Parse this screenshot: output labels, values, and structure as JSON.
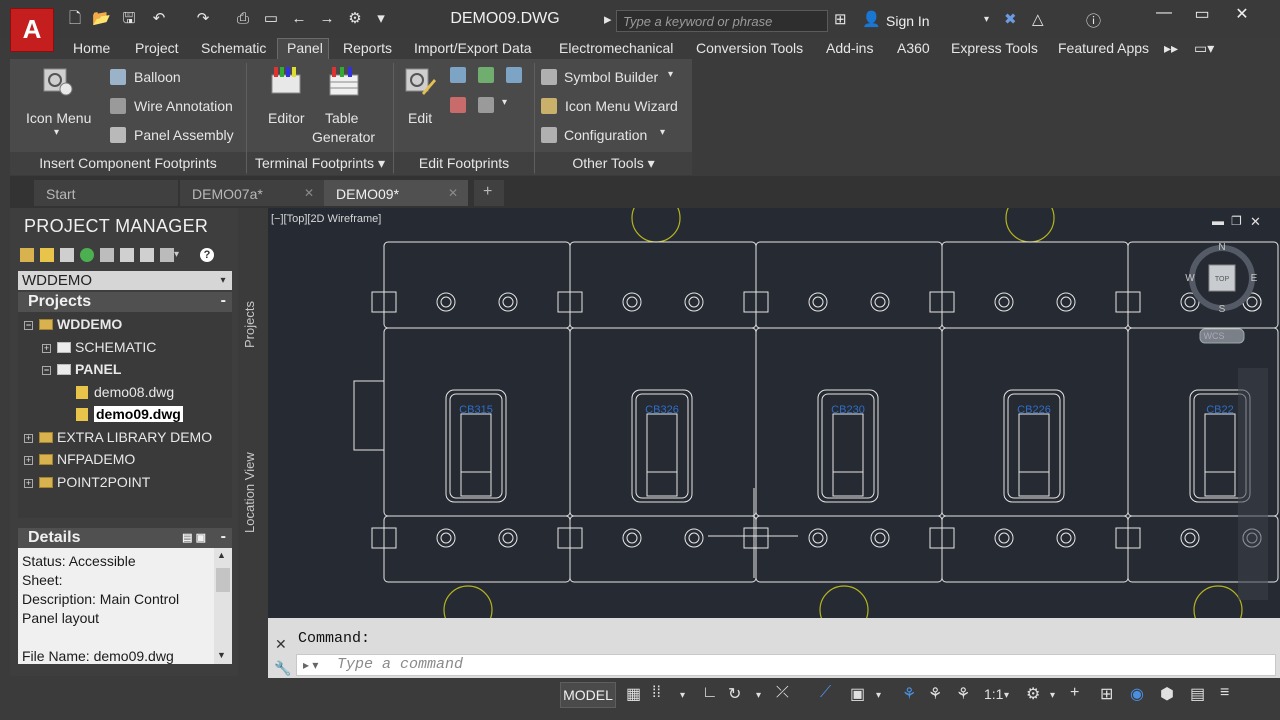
{
  "app": {
    "logo": "A",
    "document_title": "DEMO09.DWG"
  },
  "search": {
    "placeholder": "Type a keyword or phrase"
  },
  "account": {
    "sign_in_label": "Sign In"
  },
  "ribbon_tabs": [
    "Home",
    "Project",
    "Schematic",
    "Panel",
    "Reports",
    "Import/Export Data",
    "Electromechanical",
    "Conversion Tools",
    "Add-ins",
    "A360",
    "Express Tools",
    "Featured Apps"
  ],
  "active_tab": "Panel",
  "ribbon": {
    "insert_group": {
      "icon_menu": "Icon Menu",
      "balloon": "Balloon",
      "wire_annotation": "Wire Annotation",
      "panel_assembly": "Panel Assembly",
      "label": "Insert Component Footprints"
    },
    "terminal_group": {
      "editor": "Editor",
      "table_generator_1": "Table",
      "table_generator_2": "Generator",
      "label": "Terminal Footprints"
    },
    "edit_group": {
      "edit": "Edit",
      "label": "Edit Footprints"
    },
    "other_group": {
      "symbol_builder": "Symbol Builder",
      "icon_menu_wizard": "Icon Menu  Wizard",
      "configuration": "Configuration",
      "label": "Other Tools"
    }
  },
  "doc_tabs": [
    "Start",
    "DEMO07a*",
    "DEMO09*"
  ],
  "active_doc_tab": "DEMO09*",
  "project_manager": {
    "title": "PROJECT MANAGER",
    "project_selector": "WDDEMO",
    "projects_header": "Projects",
    "tree": {
      "root": "WDDEMO",
      "schematic": "SCHEMATIC",
      "panel": "PANEL",
      "file1": "demo08.dwg",
      "file2": "demo09.dwg",
      "extra": "EXTRA LIBRARY DEMO",
      "nfpa": "NFPADEMO",
      "p2p": "POINT2POINT"
    },
    "details_header": "Details",
    "details": {
      "status": "Status: Accessible",
      "sheet": "Sheet:",
      "description_1": "Description: Main Control",
      "description_2": "Panel layout",
      "file_name": "File Name: demo09.dwg"
    },
    "side_tabs": {
      "projects": "Projects",
      "location_view": "Location View"
    }
  },
  "viewport": {
    "label": "[−][Top][2D Wireframe]",
    "viewcube": {
      "n": "N",
      "s": "S",
      "e": "E",
      "w": "W",
      "top": "TOP",
      "wcs": "WCS"
    },
    "breakers": [
      "CB315",
      "CB326",
      "CB230",
      "CB226",
      "CB22"
    ]
  },
  "command": {
    "label": "Command:",
    "placeholder": "Type  a  command"
  },
  "status_bar": {
    "model": "MODEL",
    "scale": "1:1"
  }
}
